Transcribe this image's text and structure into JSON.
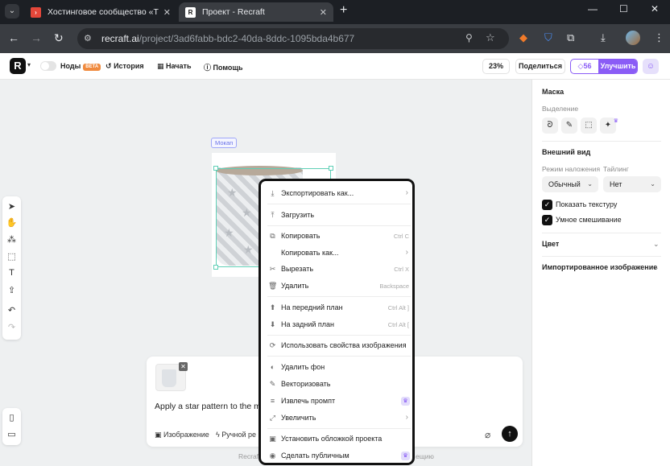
{
  "browser": {
    "tabs": [
      {
        "title": "Хостинговое сообщество «Tim"
      },
      {
        "title": "Проект - Recraft"
      }
    ],
    "url_host": "recraft.ai",
    "url_path": "/project/3ad6fabb-bdc2-40da-8ddc-1095bda4b677"
  },
  "header": {
    "nodes_label": "Ноды",
    "beta_badge": "BETA",
    "history_label": "История",
    "start_label": "Начать",
    "help_label": "Помощь",
    "zoom": "23%",
    "share_label": "Поделиться",
    "credits": "56",
    "upgrade_label": "Улучшить"
  },
  "canvas": {
    "frame_label": "Мокап"
  },
  "composer": {
    "prompt_text": "Apply a star pattern to the mug",
    "option_image": "Изображение",
    "option_manual": "Ручной ре",
    "footnote_left": "Recraft",
    "footnote_right": "ещию"
  },
  "context_menu": {
    "items": [
      {
        "label": "Экспортировать как...",
        "shortcut": "",
        "has_submenu": true,
        "icon": "download-icon"
      },
      {
        "label": "Загрузить",
        "shortcut": "",
        "icon": "upload-icon"
      },
      {
        "label": "Копировать",
        "shortcut": "Ctrl C",
        "icon": "copy-icon"
      },
      {
        "label": "Копировать как...",
        "shortcut": "",
        "has_submenu": true,
        "icon": ""
      },
      {
        "label": "Вырезать",
        "shortcut": "Ctrl X",
        "icon": "scissors-icon"
      },
      {
        "label": "Удалить",
        "shortcut": "Backspace",
        "icon": "trash-icon"
      },
      {
        "label": "На передний план",
        "shortcut": "Ctrl Alt ]",
        "icon": "bring-front-icon"
      },
      {
        "label": "На задний план",
        "shortcut": "Ctrl Alt [",
        "icon": "send-back-icon"
      },
      {
        "label": "Использовать свойства изображения",
        "shortcut": "",
        "icon": "refresh-icon"
      },
      {
        "label": "Удалить фон",
        "shortcut": "",
        "icon": "remove-bg-icon"
      },
      {
        "label": "Векторизовать",
        "shortcut": "",
        "icon": "vectorize-icon"
      },
      {
        "label": "Извлечь промпт",
        "shortcut": "",
        "premium": true,
        "icon": "extract-prompt-icon"
      },
      {
        "label": "Увеличить",
        "shortcut": "",
        "has_submenu": true,
        "icon": "upscale-icon"
      },
      {
        "label": "Установить обложкой проекта",
        "shortcut": "",
        "icon": "cover-icon"
      },
      {
        "label": "Сделать публичным",
        "shortcut": "",
        "premium": true,
        "icon": "eye-icon"
      }
    ]
  },
  "right_panel": {
    "mask_title": "Маска",
    "selection_label": "Выделение",
    "appearance_title": "Внешний вид",
    "blend_mode_label": "Режим наложения",
    "tiling_label": "Тайлинг",
    "blend_mode_value": "Обычный",
    "tiling_value": "Нет",
    "show_texture": "Показать текстуру",
    "smart_blend": "Умное смешивание",
    "color_title": "Цвет",
    "imported_image_title": "Импортированное изображение"
  },
  "colors": {
    "accent": "#8a5cf6",
    "selection": "#5fcfb6",
    "beta": "#f08a3e"
  }
}
